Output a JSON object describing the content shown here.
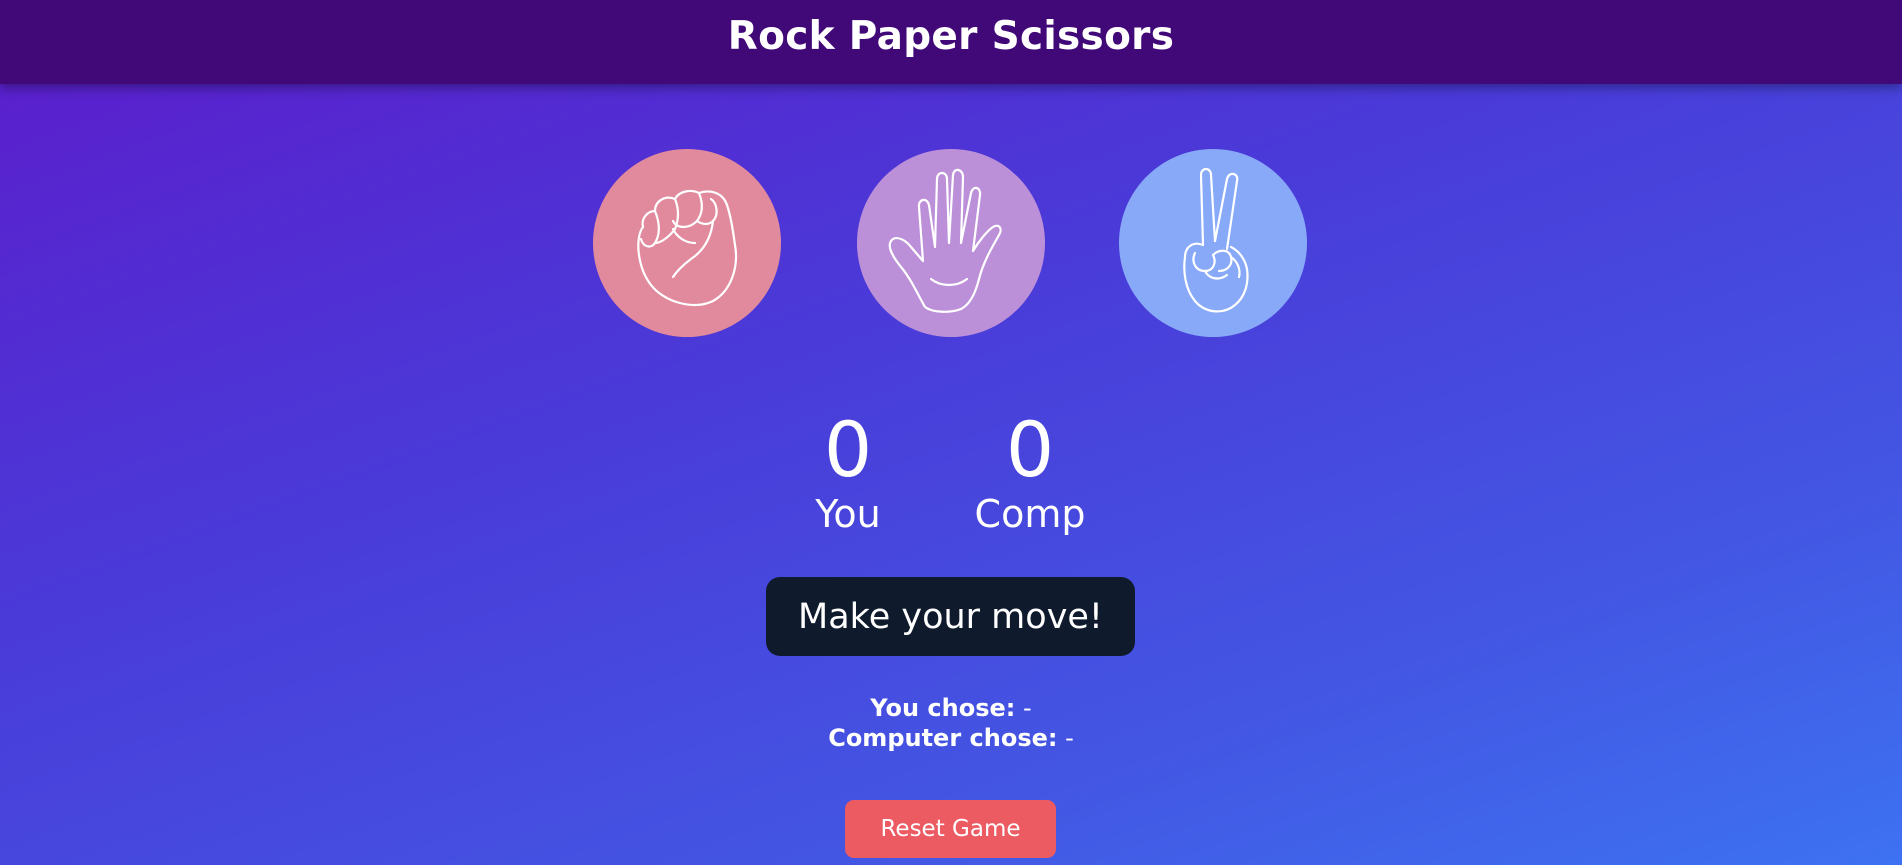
{
  "app": {
    "title": "Rock Paper Scissors"
  },
  "choices": [
    {
      "name": "rock",
      "icon": "rock-fist-icon",
      "color": "#e28a9d"
    },
    {
      "name": "paper",
      "icon": "paper-hand-icon",
      "color": "#bc90d8"
    },
    {
      "name": "scissors",
      "icon": "scissors-hand-icon",
      "color": "#88a9f8"
    }
  ],
  "scores": {
    "player_value": "0",
    "player_label": "You",
    "computer_value": "0",
    "computer_label": "Comp"
  },
  "message": "Make your move!",
  "result": {
    "you_chose_label": "You chose:",
    "you_chose_value": "-",
    "computer_chose_label": "Computer chose:",
    "computer_chose_value": "-"
  },
  "reset_label": "Reset Game",
  "colors": {
    "header": "#410878",
    "message_bg": "#0f1b2d",
    "reset_button": "#ec5a62"
  }
}
